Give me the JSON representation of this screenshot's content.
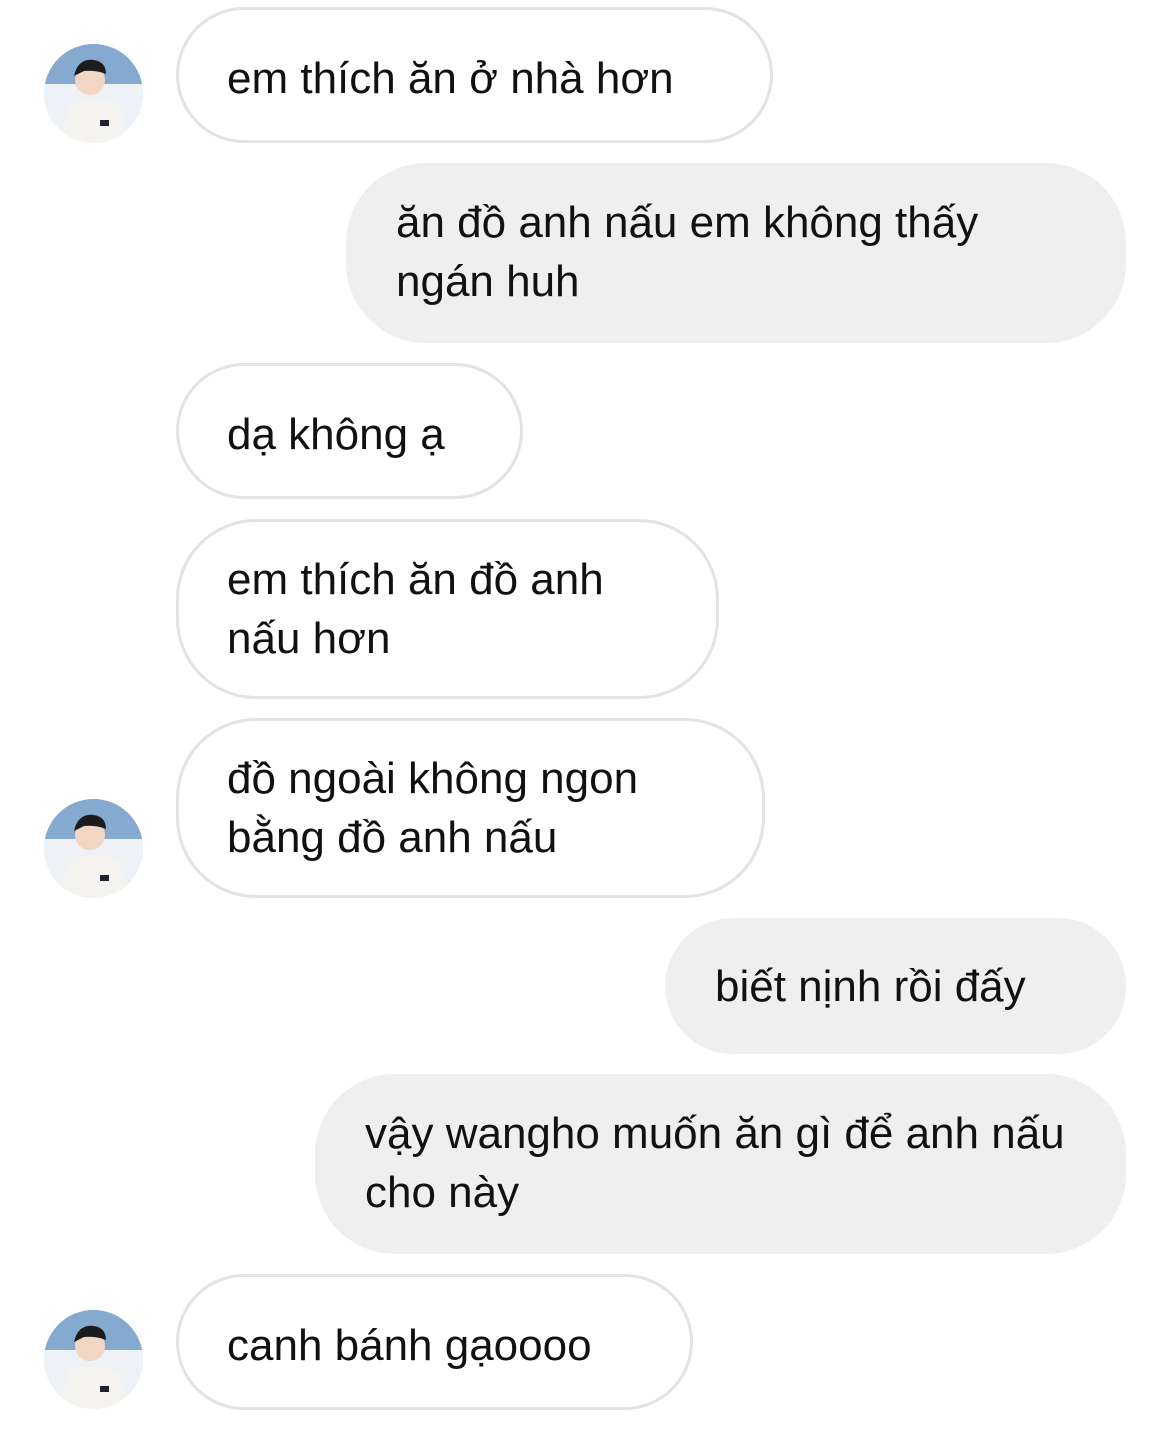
{
  "thread": {
    "messages": [
      {
        "side": "received",
        "text": "em thích ăn ở nhà hơn",
        "avatar": true
      },
      {
        "side": "sent",
        "text": "ăn đồ anh nấu em không thấy ngán huh"
      },
      {
        "side": "received",
        "text": "dạ không ạ",
        "avatar": false
      },
      {
        "side": "received",
        "text": "em thích ăn đồ anh nấu hơn",
        "avatar": false
      },
      {
        "side": "received",
        "text": "đồ ngoài không ngon bằng đồ anh nấu",
        "avatar": true
      },
      {
        "side": "sent",
        "text": "biết nịnh rồi đấy"
      },
      {
        "side": "sent",
        "text": "vậy wangho muốn ăn gì để anh nấu cho này"
      },
      {
        "side": "received",
        "text": "canh bánh gạoooo",
        "avatar": true
      }
    ]
  },
  "colors": {
    "received_bubble_bg": "#ffffff",
    "received_bubble_border": "#e3e3e3",
    "sent_bubble_bg": "#efefef",
    "text": "#111111"
  },
  "icons": {
    "avatar": "profile-photo-avatar"
  }
}
